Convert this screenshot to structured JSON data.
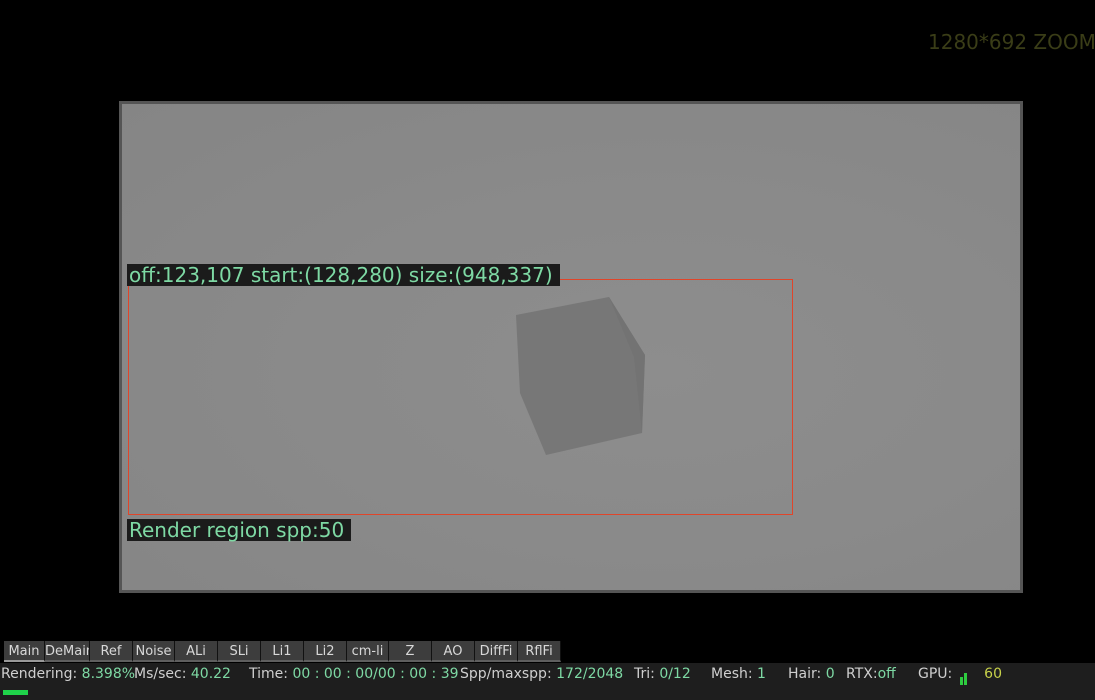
{
  "zoom_label": "1280*692 ZOOM:",
  "region": {
    "info": "off:123,107 start:(128,280) size:(948,337)",
    "spp_label": "Render region spp:50"
  },
  "tabs": [
    {
      "label": "Main",
      "active": true
    },
    {
      "label": "DeMain",
      "active": false
    },
    {
      "label": "Ref",
      "active": false
    },
    {
      "label": "Noise",
      "active": false
    },
    {
      "label": "ALi",
      "active": false
    },
    {
      "label": "SLi",
      "active": false
    },
    {
      "label": "Li1",
      "active": false
    },
    {
      "label": "Li2",
      "active": false
    },
    {
      "label": "cm-li",
      "active": false
    },
    {
      "label": "Z",
      "active": false
    },
    {
      "label": "AO",
      "active": false
    },
    {
      "label": "DiffFi",
      "active": false
    },
    {
      "label": "RflFi",
      "active": false
    }
  ],
  "status": {
    "rendering_label": "Rendering:",
    "rendering_value": "8.398%",
    "mssec_label": "Ms/sec:",
    "mssec_value": "40.22",
    "time_label": "Time:",
    "time_value": "00 : 00 : 00/00 : 00 : 39",
    "spp_label": "Spp/maxspp:",
    "spp_value": "172/2048",
    "tri_label": "Tri:",
    "tri_value": "0/12",
    "mesh_label": "Mesh:",
    "mesh_value": "1",
    "hair_label": "Hair:",
    "hair_value": "0",
    "rtx_label": "RTX:",
    "rtx_value": "off",
    "gpu_label": "GPU:",
    "gpu_value": "60"
  },
  "progress": 0.08398,
  "colors": {
    "accent_green": "#7ed9a4",
    "region_border": "#e0452a",
    "progress_green": "#1fd34a"
  }
}
